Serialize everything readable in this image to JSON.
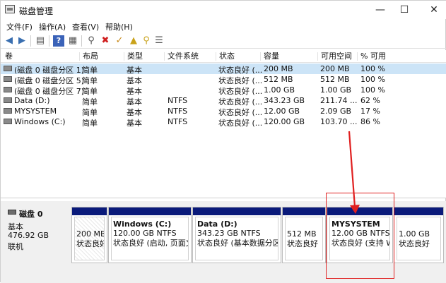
{
  "window": {
    "title": "磁盘管理"
  },
  "menu": {
    "items": [
      "文件(F)",
      "操作(A)",
      "查看(V)",
      "帮助(H)"
    ]
  },
  "table": {
    "headers": [
      "卷",
      "布局",
      "类型",
      "文件系统",
      "状态",
      "容量",
      "可用空间",
      "% 可用"
    ],
    "rows": [
      [
        "(磁盘 0 磁盘分区 1)",
        "简单",
        "基本",
        "",
        "状态良好 (...",
        "200 MB",
        "200 MB",
        "100 %"
      ],
      [
        "(磁盘 0 磁盘分区 5)",
        "简单",
        "基本",
        "",
        "状态良好 (...",
        "512 MB",
        "512 MB",
        "100 %"
      ],
      [
        "(磁盘 0 磁盘分区 7)",
        "简单",
        "基本",
        "",
        "状态良好 (...",
        "1.00 GB",
        "1.00 GB",
        "100 %"
      ],
      [
        "Data (D:)",
        "简单",
        "基本",
        "NTFS",
        "状态良好 (...",
        "343.23 GB",
        "211.74 ...",
        "62 %"
      ],
      [
        "MYSYSTEM",
        "简单",
        "基本",
        "NTFS",
        "状态良好 (...",
        "12.00 GB",
        "2.09 GB",
        "17 %"
      ],
      [
        "Windows (C:)",
        "简单",
        "基本",
        "NTFS",
        "状态良好 (...",
        "120.00 GB",
        "103.70 ...",
        "86 %"
      ]
    ]
  },
  "disk": {
    "name": "磁盘 0",
    "type": "基本",
    "size": "476.92 GB",
    "status": "联机",
    "partitions": [
      {
        "name": "",
        "size": "200 MB",
        "status": "状态良好"
      },
      {
        "name": "Windows  (C:)",
        "size": "120.00 GB NTFS",
        "status": "状态良好 (启动, 页面文"
      },
      {
        "name": "Data  (D:)",
        "size": "343.23 GB NTFS",
        "status": "状态良好 (基本数据分区)"
      },
      {
        "name": "",
        "size": "512 MB",
        "status": "状态良好"
      },
      {
        "name": "MYSYSTEM",
        "size": "12.00 GB NTFS",
        "status": "状态良好 (支持 Wi"
      },
      {
        "name": "",
        "size": "1.00 GB",
        "status": "状态良好"
      }
    ]
  },
  "colors": {
    "partition_bar": "#0a1a7a",
    "annotation": "#e02020",
    "selection": "#cce4f7"
  },
  "icons": [
    "back-icon",
    "forward-icon",
    "properties-icon",
    "help-icon",
    "refresh-icon",
    "connect-icon",
    "delete-icon",
    "check-icon",
    "folder-up-icon",
    "search-icon",
    "list-icon"
  ]
}
